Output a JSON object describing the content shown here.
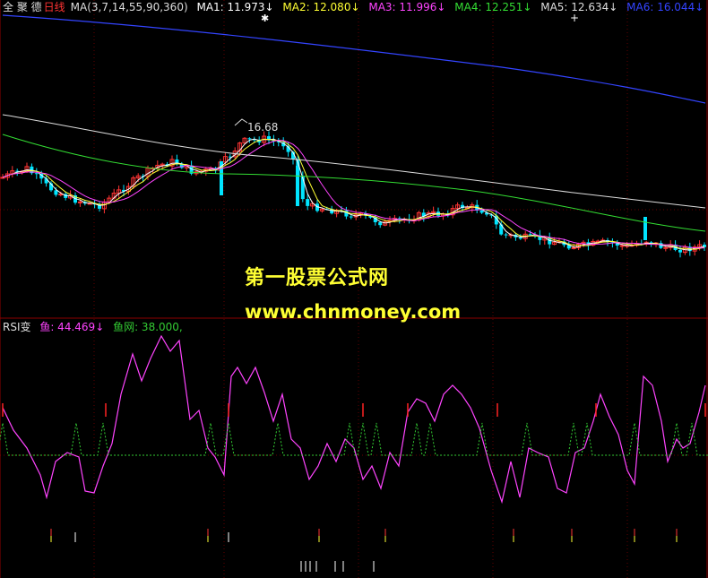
{
  "header": {
    "stock_name": "全 聚 德",
    "period": "日线",
    "ma_label": "MA(3,7,14,55,90,360)",
    "ma_lines": [
      {
        "label": "MA1: 11.973",
        "arrow": "↓",
        "color": "#ffffff"
      },
      {
        "label": "MA2: 12.080",
        "arrow": "↓",
        "color": "#ffff33"
      },
      {
        "label": "MA3: 11.996",
        "arrow": "↓",
        "color": "#ff44ff"
      },
      {
        "label": "MA4: 12.251",
        "arrow": "↓",
        "color": "#33dd33"
      },
      {
        "label": "MA5: 12.634",
        "arrow": "↓",
        "color": "#dddddd"
      },
      {
        "label": "MA6: 16.044",
        "arrow": "↓",
        "color": "#3344ff"
      }
    ]
  },
  "price_panel": {
    "high_marker": "16.68"
  },
  "rsi_panel": {
    "name": "RSI变",
    "series": [
      {
        "label": "鱼: 44.469",
        "arrow": "↓",
        "color": "#ff44ff"
      },
      {
        "label": "鱼网: 38.000,",
        "color": "#33cc33"
      }
    ]
  },
  "watermark": {
    "title": "第一股票公式网",
    "url": "www.chnmoney.com"
  },
  "colors": {
    "background": "#000000",
    "grid": "#8b0000",
    "up_candle": "#ff3333",
    "down_candle": "#00e5ff",
    "ma1": "#ffffff",
    "ma2": "#ffff33",
    "ma3": "#ff44ff",
    "ma4": "#33dd33",
    "ma5": "#dddddd",
    "ma6": "#3344ff"
  }
}
